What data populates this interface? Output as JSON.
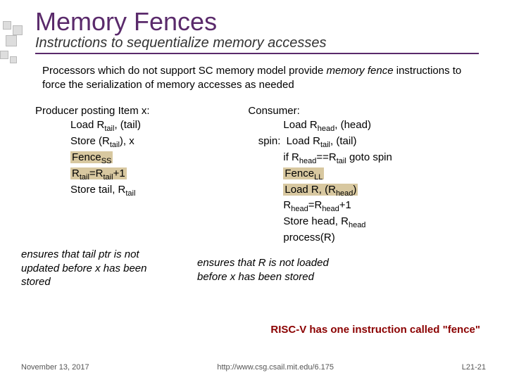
{
  "title": "Memory Fences",
  "subtitle": "Instructions to sequentialize memory accesses",
  "intro_pre": "Processors which do not support SC memory model provide ",
  "intro_em": "memory fence",
  "intro_post": " instructions to force the serialization of memory accesses as needed",
  "producer": {
    "header": "Producer posting Item x:",
    "l1a": "Load R",
    "l1b": "tail",
    "l1c": ", (tail)",
    "l2a": "Store (R",
    "l2b": "tail",
    "l2c": "), x",
    "l3a": "Fence",
    "l3b": "SS",
    "l4a": "R",
    "l4b": "tail",
    "l4c": "=R",
    "l4d": "tail",
    "l4e": "+1",
    "l5a": "Store tail, R",
    "l5b": "tail"
  },
  "consumer": {
    "header": "Consumer:",
    "l1a": "Load R",
    "l1b": "head",
    "l1c": ", (head)",
    "spin": "spin:",
    "l2a": "Load R",
    "l2b": "tail",
    "l2c": ", (tail)",
    "l3a": "if R",
    "l3b": "head",
    "l3c": "==R",
    "l3d": "tail",
    "l3e": " goto spin",
    "l4a": "Fence",
    "l4b": "LL",
    "l5a": "Load R, (R",
    "l5b": "head",
    "l5c": ")",
    "l6a": "R",
    "l6b": "head",
    "l6c": "=R",
    "l6d": "head",
    "l6e": "+1",
    "l7a": "Store head, R",
    "l7b": "head",
    "l8": "process(R)"
  },
  "note_left": "ensures that tail ptr is not updated before x has been stored",
  "note_mid": "ensures that R is not loaded before x has been stored",
  "risc": "RISC-V has one instruction called \"fence\"",
  "footer": {
    "date": "November 13, 2017",
    "url": "http://www.csg.csail.mit.edu/6.175",
    "page": "L21-21"
  }
}
